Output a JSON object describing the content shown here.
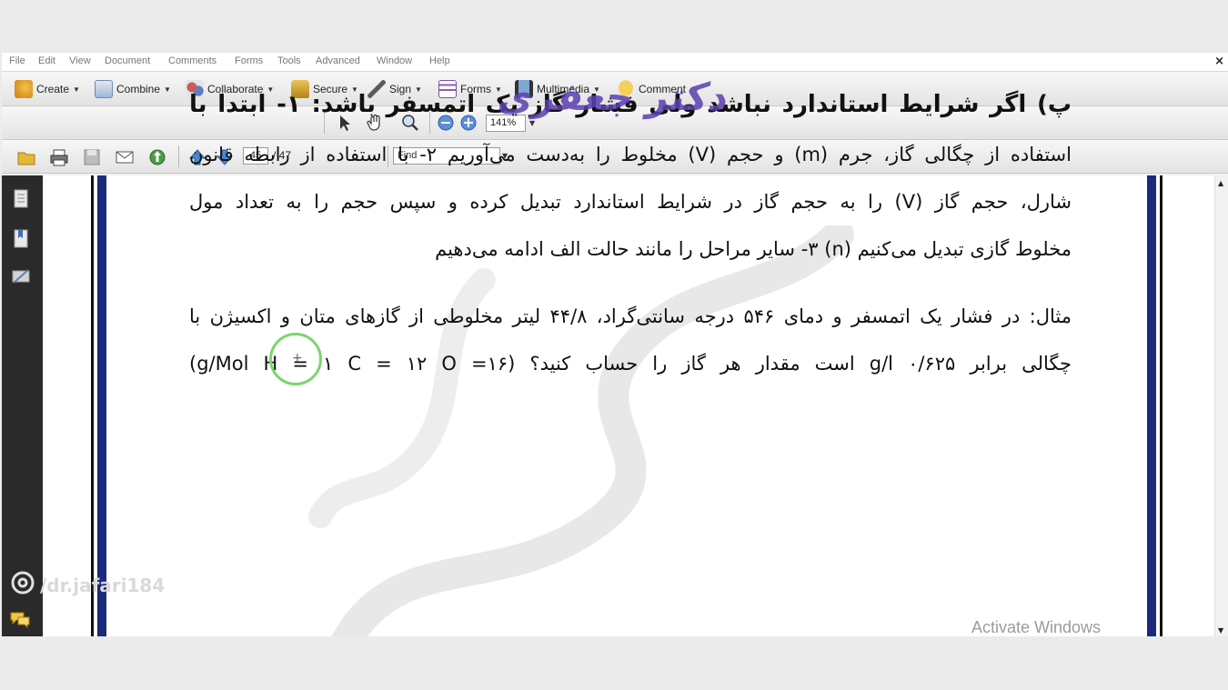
{
  "menu": [
    "File",
    "Edit",
    "View",
    "Document",
    "Comments",
    "Forms",
    "Tools",
    "Advanced",
    "Window",
    "Help"
  ],
  "close_label": "×",
  "toolbar1": {
    "create": "Create",
    "combine": "Combine",
    "collaborate": "Collaborate",
    "secure": "Secure",
    "sign": "Sign",
    "forms": "Forms",
    "multimedia": "Multimedia",
    "comment": "Comment"
  },
  "toolbar2": {
    "zoom": "141%"
  },
  "toolbar3": {
    "page_current": "45",
    "page_total": "/ 47",
    "find_placeholder": "Find"
  },
  "document": {
    "lines": [
      "پ) اگر شرایط استاندارد نباشد ولی فشار گاز یک اتمسفر باشد: ۱-  ابتدا با",
      "استفاده از چگالی گاز، جرم (m) و حجم (V) مخلوط را به‌دست می‌آوریم  ۲- با استفاده از رابطه قانون",
      "شارل، حجم گاز (V) را به حجم گاز در شرایط استاندارد تبدیل کرده و سپس حجم را به  تعداد مول",
      "مخلوط گازی تبدیل می‌کنیم (n) ۳- سایر مراحل را مانند حالت الف ادامه می‌دهیم",
      "مثال: در فشار یک اتمسفر و دمای ۵۴۶ درجه سانتی‌گراد، ۴۴/۸ لیتر مخلوطی از گازهای متان و اکسیژن با",
      "چگالی برابر g/l ۰/۶۲۵ است مقدار هر گاز را حساب کنید؟ (g/Mol  H = ۱    C = ۱۲       O =۱۶)"
    ]
  },
  "watermark": "دکتر جعفری",
  "social_handle": "/dr.jafari184",
  "activate_windows": "Activate Windows",
  "colors": {
    "nav_bg": "#2a2a2a",
    "page_border": "#1c2a7a",
    "watermark": "#5b3fb0"
  }
}
